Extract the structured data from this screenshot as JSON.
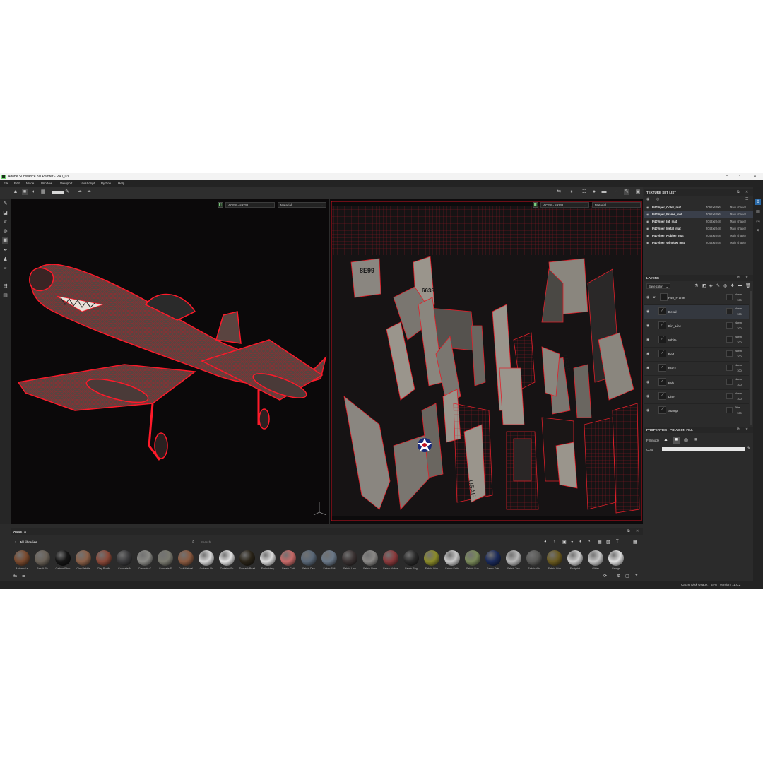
{
  "window": {
    "title": "Adobe Substance 3D Painter - P40_03"
  },
  "menu": [
    "File",
    "Edit",
    "Mode",
    "Window",
    "Viewport",
    "JavaScript",
    "Python",
    "Help"
  ],
  "viewport_left": {
    "color_space": "ACES - sRGB",
    "channel": "Material"
  },
  "viewport_right": {
    "color_space": "ACES - sRGB",
    "channel": "Material"
  },
  "uv_labels": {
    "number1": "8E99",
    "number2": "6638",
    "text1": "USAF",
    "text2": "USAF"
  },
  "texture_set_list": {
    "title": "TEXTURE SET LIST",
    "rows": [
      {
        "name": "P40Viper_Color_mat",
        "res": "4096x4096",
        "shader": "Main shader"
      },
      {
        "name": "P40Viper_Frame_mat",
        "res": "4096x4096",
        "shader": "Main shader"
      },
      {
        "name": "P40Viper_Int_mat",
        "res": "2048x2048",
        "shader": "Main shader"
      },
      {
        "name": "P40Viper_Metal_mat",
        "res": "2048x2048",
        "shader": "Main shader"
      },
      {
        "name": "P40Viper_Rubber_mat",
        "res": "2048x2048",
        "shader": "Main shader"
      },
      {
        "name": "P40Viper_Window_mat",
        "res": "2048x2048",
        "shader": "Main shader"
      }
    ]
  },
  "layers": {
    "title": "LAYERS",
    "channel": "Base color",
    "rows": [
      {
        "name": "P40_Frame",
        "blend": "Norm",
        "opacity": "100"
      },
      {
        "name": "Decal",
        "blend": "Norm",
        "opacity": "100"
      },
      {
        "name": "Dirt_Line",
        "blend": "Norm",
        "opacity": "100"
      },
      {
        "name": "White",
        "blend": "Norm",
        "opacity": "100"
      },
      {
        "name": "Red",
        "blend": "Norm",
        "opacity": "100"
      },
      {
        "name": "Black",
        "blend": "Norm",
        "opacity": "100"
      },
      {
        "name": "Bolt",
        "blend": "Norm",
        "opacity": "100"
      },
      {
        "name": "Line",
        "blend": "Norm",
        "opacity": "100"
      },
      {
        "name": "Stamp",
        "blend": "Pthr",
        "opacity": "100"
      }
    ]
  },
  "properties": {
    "title": "PROPERTIES - POLYGON FILL",
    "fill_mode_label": "Fill mode",
    "color_label": "Color"
  },
  "assets": {
    "title": "ASSETS",
    "library": "All libraries",
    "search_placeholder": "Search",
    "items": [
      {
        "label": "Autumn Le",
        "color": "#7a4a2e"
      },
      {
        "label": "Basalt Ro",
        "color": "#6a6258"
      },
      {
        "label": "Carbon Fiber",
        "color": "#151515"
      },
      {
        "label": "Clay Pebble",
        "color": "#8a6048"
      },
      {
        "label": "Clay Roofin",
        "color": "#8a4838"
      },
      {
        "label": "Concrete A",
        "color": "#3a3a3c"
      },
      {
        "label": "Concrete C",
        "color": "#8a8a86"
      },
      {
        "label": "Concrete S",
        "color": "#7a7a70"
      },
      {
        "label": "Cork Natural",
        "color": "#8a5a40"
      },
      {
        "label": "Curtains Sh",
        "color": "#d8d8d8"
      },
      {
        "label": "Curtains Sh",
        "color": "#e2e2e2"
      },
      {
        "label": "Damask Bead",
        "color": "#2a2418"
      },
      {
        "label": "Embroidery",
        "color": "#dddddd"
      },
      {
        "label": "Fabric Cott",
        "color": "#c86a68"
      },
      {
        "label": "Fabric Den",
        "color": "#5a6878"
      },
      {
        "label": "Fabric Felt",
        "color": "#6a7888"
      },
      {
        "label": "Fabric Line",
        "color": "#3a3232"
      },
      {
        "label": "Fabric Lines",
        "color": "#8a8886"
      },
      {
        "label": "Fabric Nubus",
        "color": "#8a3a3c"
      },
      {
        "label": "Fabric Rug",
        "color": "#2a2a2a"
      },
      {
        "label": "Fabric Woo",
        "color": "#8a8a2a"
      },
      {
        "label": "Fabric Satin",
        "color": "#c8c8c8"
      },
      {
        "label": "Fabric Suo",
        "color": "#7a8a5a"
      },
      {
        "label": "Fabric Twis",
        "color": "#1a2a5a"
      },
      {
        "label": "Fabric Twe",
        "color": "#b8b8b8"
      },
      {
        "label": "Fabric Wic",
        "color": "#5a5a58"
      },
      {
        "label": "Fabric Woo",
        "color": "#6a5a20"
      },
      {
        "label": "Footprint",
        "color": "#d0d0d0"
      },
      {
        "label": "Glitter",
        "color": "#c8c8c8"
      },
      {
        "label": "Grunge",
        "color": "#e0e0e0"
      }
    ]
  },
  "status": {
    "cache": "Cache Disk Usage:",
    "version": "64% | Version: 11.0.2 (OpenGL)"
  }
}
